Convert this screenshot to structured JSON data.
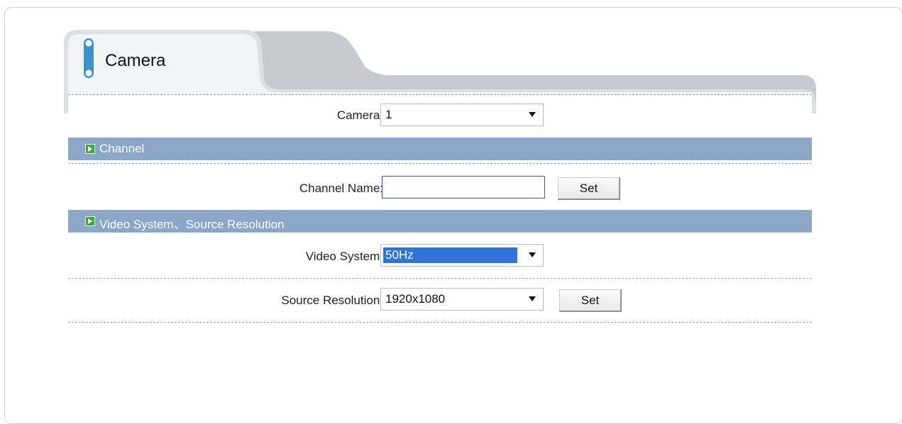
{
  "tab": {
    "title": "Camera"
  },
  "camera_row": {
    "label": "Camera:",
    "value": "1"
  },
  "channel_section": {
    "title": "Channel"
  },
  "channel_name_row": {
    "label": "Channel Name:",
    "value": "",
    "button": "Set"
  },
  "video_section": {
    "title": "Video System、Source Resolution"
  },
  "video_system_row": {
    "label": "Video System:",
    "value": "50Hz"
  },
  "source_resolution_row": {
    "label": "Source Resolution:",
    "value": "1920x1080",
    "button": "Set"
  },
  "colors": {
    "section_bar": "#8aa7c8",
    "tab_gray": "#c7cbd1",
    "selected_highlight": "#2f74d6",
    "icon_green": "#3aa93a",
    "pill_blue": "#3b93c7"
  },
  "icons": {
    "tab": "camera-pill-icon",
    "section": "green-arrow-icon",
    "dropdown": "chevron-down-icon"
  }
}
